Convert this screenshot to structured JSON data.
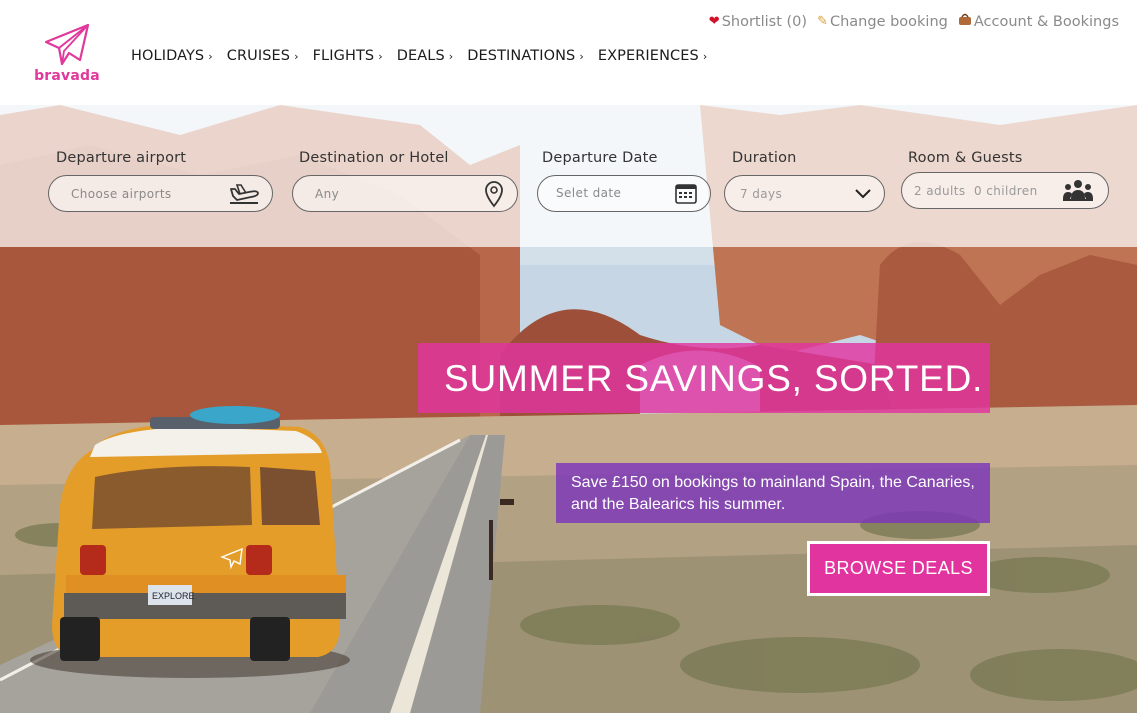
{
  "brand": {
    "name": "bravada",
    "accent": "#e0389b"
  },
  "top_links": [
    {
      "icon": "heart-icon",
      "label": "Shortlist (0)"
    },
    {
      "icon": "pencil-icon",
      "label": "Change booking"
    },
    {
      "icon": "bag-icon",
      "label": "Account & Bookings"
    }
  ],
  "nav": [
    {
      "label": "HOLIDAYS"
    },
    {
      "label": "CRUISES"
    },
    {
      "label": "FLIGHTS"
    },
    {
      "label": "DEALS"
    },
    {
      "label": "DESTINATIONS"
    },
    {
      "label": "EXPERIENCES"
    }
  ],
  "search": {
    "departure": {
      "label": "Departure  airport",
      "placeholder": "Choose  airports",
      "icon": "plane-takeoff-icon"
    },
    "destination": {
      "label": "Destination or Hotel",
      "placeholder": "Any",
      "icon": "map-pin-icon"
    },
    "date": {
      "label": "Departure Date",
      "placeholder": "Selet  date",
      "icon": "calendar-icon"
    },
    "duration": {
      "label": "Duration",
      "value": "7  days",
      "icon": "chevron-down-icon"
    },
    "guests": {
      "label": "Room & Guests",
      "adults": "2  adults",
      "children": "0  children",
      "icon": "group-icon"
    }
  },
  "promo": {
    "headline": "SUMMER SAVINGS, SORTED.",
    "subtext": "Save £150 on bookings to mainland Spain, the Canaries, and the Balearics his summer.",
    "cta": "BROWSE DEALS",
    "headline_color": "#e234a0",
    "subtext_color": "#7c36ba"
  },
  "van": {
    "plate": "EXPLORE"
  }
}
